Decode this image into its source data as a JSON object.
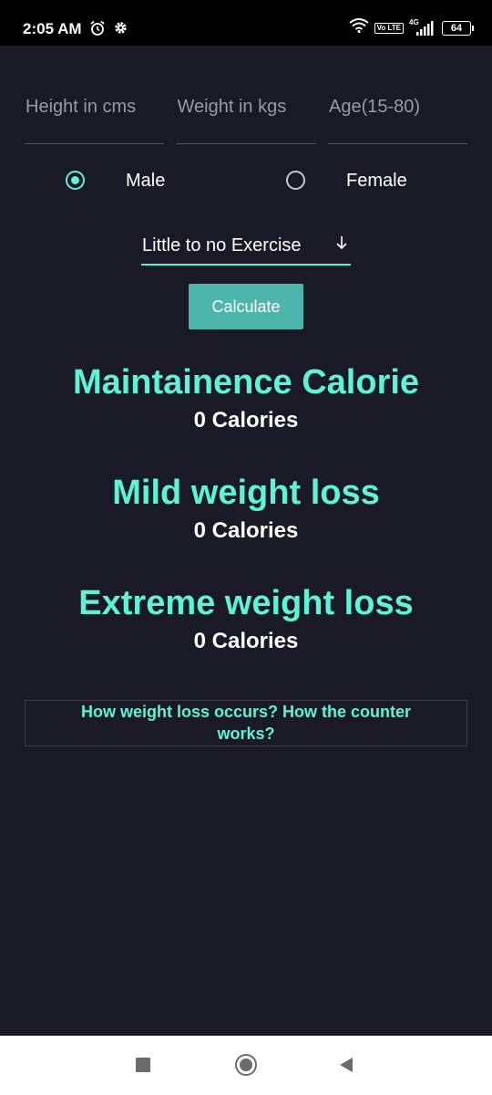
{
  "status_bar": {
    "time": "2:05 AM",
    "battery": "64",
    "network": "4G",
    "volte": "Vo LTE",
    "left_icons": [
      "alarm-icon",
      "gear-icon"
    ],
    "right_icons": [
      "wifi-icon",
      "volte-icon",
      "signal-icon",
      "battery-icon"
    ]
  },
  "form": {
    "height_placeholder": "Height in cms",
    "weight_placeholder": "Weight in kgs",
    "age_placeholder": "Age(15-80)",
    "height_value": "",
    "weight_value": "",
    "age_value": ""
  },
  "gender": {
    "male_label": "Male",
    "female_label": "Female",
    "selected": "Male"
  },
  "activity": {
    "selected": "Little to no Exercise"
  },
  "calculate_label": "Calculate",
  "results": [
    {
      "title": "Maintainence Calorie",
      "value": "0 Calories"
    },
    {
      "title": "Mild weight loss",
      "value": "0 Calories"
    },
    {
      "title": "Extreme weight loss",
      "value": "0 Calories"
    }
  ],
  "info_link": "How weight loss occurs? How the counter works?",
  "colors": {
    "background": "#1a1a26",
    "accent": "#5ef2d6",
    "button": "#4db6ac",
    "text": "#ffffff"
  },
  "nav": {
    "icons": [
      "recents-square-icon",
      "home-circle-icon",
      "back-triangle-icon"
    ]
  }
}
